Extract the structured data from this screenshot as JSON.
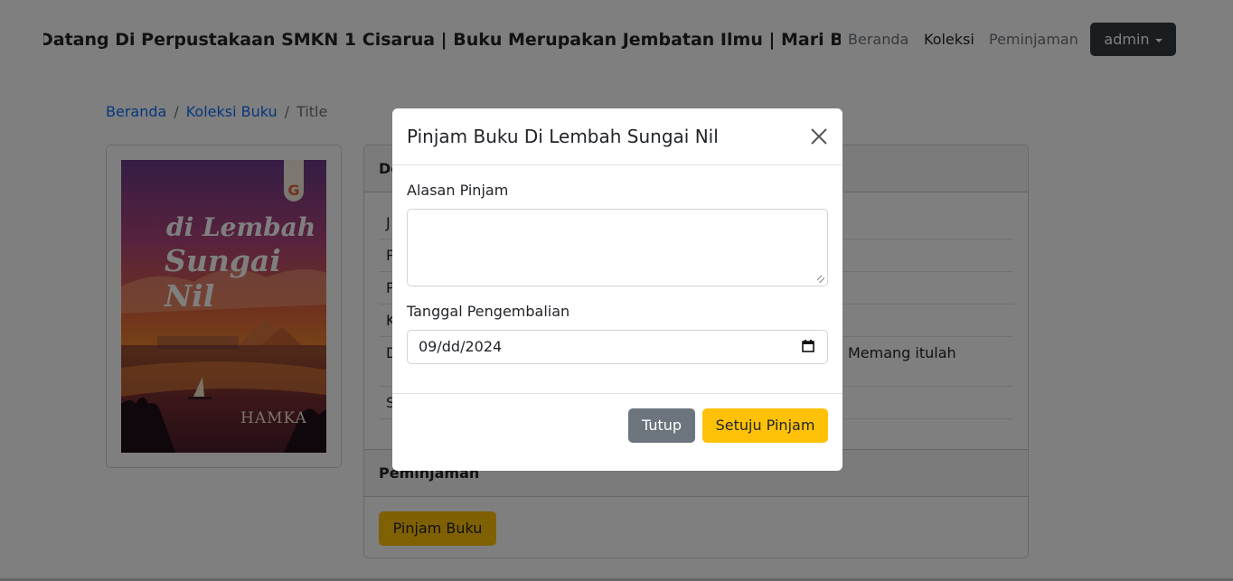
{
  "navbar": {
    "marquee": "Datang Di Perpustakaan SMKN 1 Cisarua | Buku Merupakan Jembatan Ilmu | Mari Buc",
    "links": [
      "Beranda",
      "Koleksi",
      "Peminjaman"
    ],
    "active_link": "Koleksi",
    "user_menu": "admin"
  },
  "breadcrumb": {
    "items": [
      "Beranda",
      "Koleksi Buku",
      "Title"
    ]
  },
  "book": {
    "cover": {
      "publisher_letter": "G",
      "title_line1": "di Lembah",
      "title_line2": "Sungai Nil",
      "author": "HAMKA"
    },
    "detail_header_partial": "De",
    "row_initials": [
      "J",
      "P",
      "P",
      "K",
      "D",
      "S"
    ],
    "description_partial": "Memang itulah",
    "loan_section_header": "Peminjaman",
    "loan_button": "Pinjam Buku"
  },
  "modal": {
    "title": "Pinjam Buku Di Lembah Sungai Nil",
    "reason_label": "Alasan Pinjam",
    "reason_value": "",
    "return_date_label": "Tanggal Pengembalian",
    "return_date_value": "09/dd/2024",
    "close_button": "Tutup",
    "confirm_button": "Setuju Pinjam"
  },
  "colors": {
    "primary": "#0d6efd",
    "warning": "#ffc107",
    "secondary": "#6c757d",
    "dark": "#343a40",
    "overlay": "rgba(0,0,0,0.5)"
  }
}
